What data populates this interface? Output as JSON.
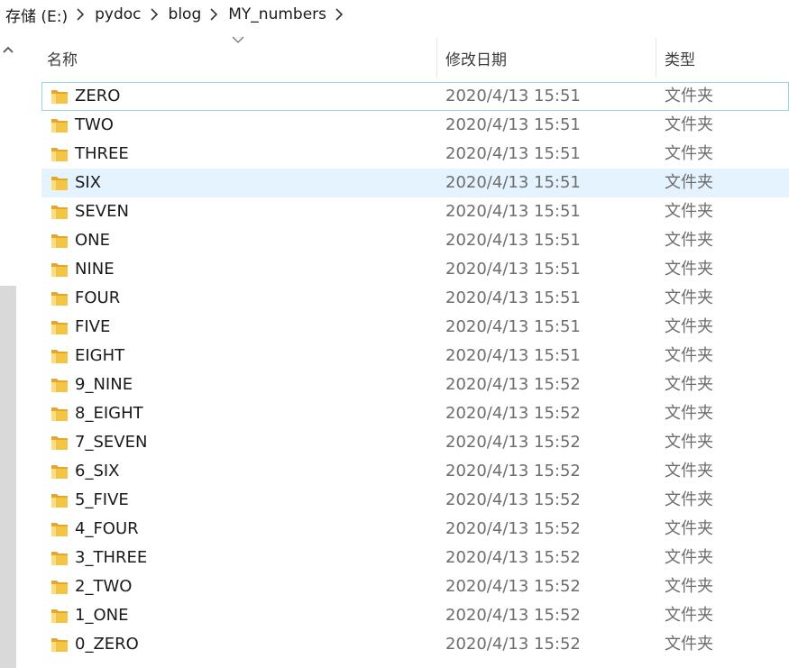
{
  "breadcrumb": [
    "存储 (E:)",
    "pydoc",
    "blog",
    "MY_numbers"
  ],
  "columns": {
    "name": "名称",
    "date": "修改日期",
    "type": "类型"
  },
  "colors": {
    "selected_row": "#e5f3ff",
    "focus_border": "#99d1e8",
    "folder": "#f4c545"
  },
  "rows": [
    {
      "name": "ZERO",
      "date": "2020/4/13 15:51",
      "type": "文件夹"
    },
    {
      "name": "TWO",
      "date": "2020/4/13 15:51",
      "type": "文件夹"
    },
    {
      "name": "THREE",
      "date": "2020/4/13 15:51",
      "type": "文件夹"
    },
    {
      "name": "SIX",
      "date": "2020/4/13 15:51",
      "type": "文件夹"
    },
    {
      "name": "SEVEN",
      "date": "2020/4/13 15:51",
      "type": "文件夹"
    },
    {
      "name": "ONE",
      "date": "2020/4/13 15:51",
      "type": "文件夹"
    },
    {
      "name": "NINE",
      "date": "2020/4/13 15:51",
      "type": "文件夹"
    },
    {
      "name": "FOUR",
      "date": "2020/4/13 15:51",
      "type": "文件夹"
    },
    {
      "name": "FIVE",
      "date": "2020/4/13 15:51",
      "type": "文件夹"
    },
    {
      "name": "EIGHT",
      "date": "2020/4/13 15:51",
      "type": "文件夹"
    },
    {
      "name": "9_NINE",
      "date": "2020/4/13 15:52",
      "type": "文件夹"
    },
    {
      "name": "8_EIGHT",
      "date": "2020/4/13 15:52",
      "type": "文件夹"
    },
    {
      "name": "7_SEVEN",
      "date": "2020/4/13 15:52",
      "type": "文件夹"
    },
    {
      "name": "6_SIX",
      "date": "2020/4/13 15:52",
      "type": "文件夹"
    },
    {
      "name": "5_FIVE",
      "date": "2020/4/13 15:52",
      "type": "文件夹"
    },
    {
      "name": "4_FOUR",
      "date": "2020/4/13 15:52",
      "type": "文件夹"
    },
    {
      "name": "3_THREE",
      "date": "2020/4/13 15:52",
      "type": "文件夹"
    },
    {
      "name": "2_TWO",
      "date": "2020/4/13 15:52",
      "type": "文件夹"
    },
    {
      "name": "1_ONE",
      "date": "2020/4/13 15:52",
      "type": "文件夹"
    },
    {
      "name": "0_ZERO",
      "date": "2020/4/13 15:52",
      "type": "文件夹"
    }
  ]
}
